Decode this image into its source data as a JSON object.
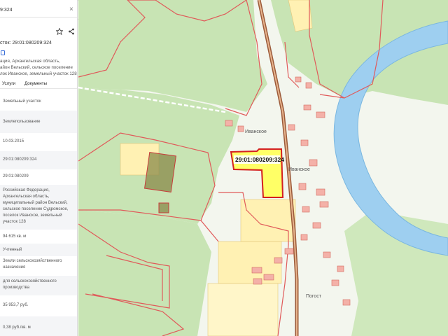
{
  "search": {
    "query": "9:324",
    "clear_glyph": "×"
  },
  "panel": {
    "title": "сток: 29:01:080209:324",
    "address_lines": [
      "ация, Архангельская область,",
      "айон Вельский, сельское поселение",
      "лок Иванское, земельный участок 128"
    ],
    "tabs": [
      "Услуги",
      "Документы"
    ],
    "rows": [
      [
        "Земельный участок"
      ],
      [
        "Землепользование"
      ],
      [
        "10.03.2015"
      ],
      [
        "29:01:080209:324"
      ],
      [
        "29:01:080209"
      ],
      [
        "Российская Федерация,",
        "Архангельская область,",
        "муниципальный район Вельский,",
        "сельское поселение Судромское,",
        "поселок Иванское, земельный",
        "участок 128"
      ],
      [
        "94 615 кв. м"
      ],
      [
        "Учтенный"
      ],
      [
        "Земли сельскохозяйственного",
        "назначения"
      ],
      [
        "для сельскохозяйственного",
        "производства"
      ],
      [
        "35 953,7 руб."
      ],
      [
        "0,38 руб./кв. м"
      ]
    ]
  },
  "icons": [
    "close-icon",
    "star-icon",
    "share-icon",
    "copy-icon",
    "chevron-left-icon"
  ],
  "map": {
    "selected_parcel_label": "29:01:080209:324",
    "place_labels": [
      "Иванское",
      "Иванское",
      "Погост"
    ],
    "colors": {
      "forest": "#c8e4b4",
      "water": "#9ecff0",
      "field": "#fff1b3",
      "selected": "#ffff66",
      "boundary": "#e05a5a",
      "road": "#9b5a3a"
    }
  }
}
